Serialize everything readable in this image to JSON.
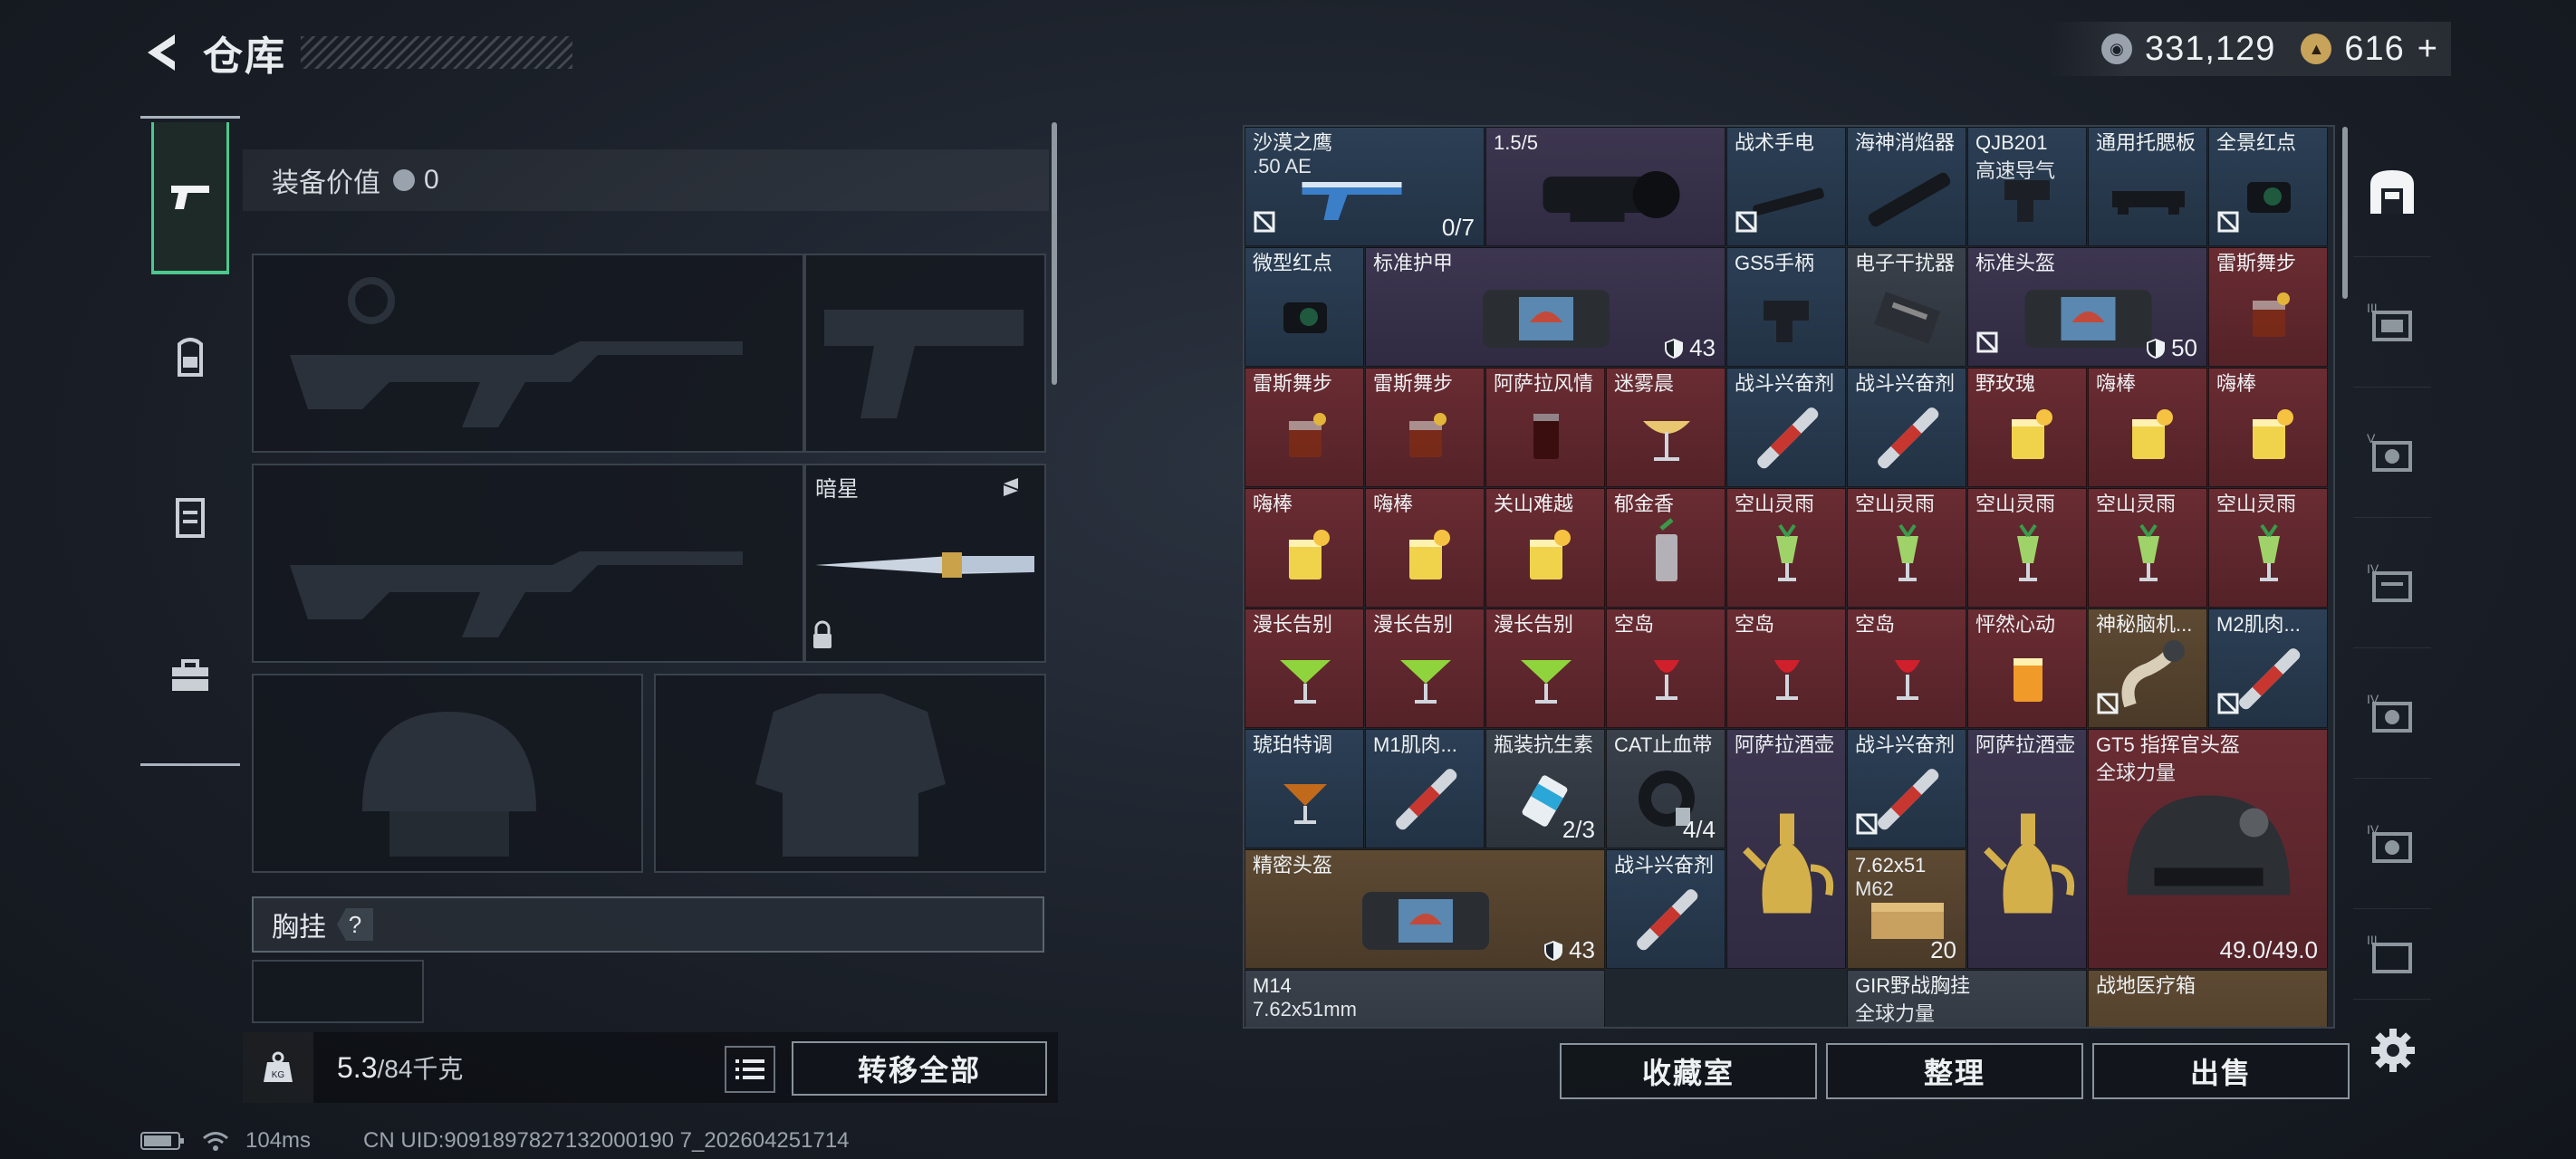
{
  "header": {
    "title": "仓库"
  },
  "currency": {
    "coins": "331,129",
    "premium": "616",
    "premium_plus": "+"
  },
  "equipment": {
    "value_label": "装备价值",
    "value": "0",
    "melee_label": "暗星",
    "chest_label": "胸挂",
    "help": "?"
  },
  "weight": {
    "current": "5.3",
    "max": "/84千克"
  },
  "buttons": {
    "transfer_all": "转移全部",
    "collection": "收藏室",
    "sort": "整理",
    "sell": "出售"
  },
  "inventory": [
    {
      "name": "沙漠之鹰",
      "sub": ".50 AE",
      "qty": "0/7"
    },
    {
      "name": "1.5/5"
    },
    {
      "name": "战术手电"
    },
    {
      "name": "海神消焰器"
    },
    {
      "name": "QJB201",
      "sub": "高速导气"
    },
    {
      "name": "通用托腮板"
    },
    {
      "name": "全景红点"
    },
    {
      "name": "微型红点"
    },
    {
      "name": "标准护甲",
      "armor": "43"
    },
    {
      "name": "GS5手柄"
    },
    {
      "name": "电子干扰器"
    },
    {
      "name": "标准头盔",
      "armor": "50"
    },
    {
      "name": "雷斯舞步"
    },
    {
      "name": "雷斯舞步"
    },
    {
      "name": "雷斯舞步"
    },
    {
      "name": "阿萨拉风情"
    },
    {
      "name": "迷雾晨"
    },
    {
      "name": "战斗兴奋剂"
    },
    {
      "name": "战斗兴奋剂"
    },
    {
      "name": "野玫瑰"
    },
    {
      "name": "嗨棒"
    },
    {
      "name": "嗨棒"
    },
    {
      "name": "嗨棒"
    },
    {
      "name": "嗨棒"
    },
    {
      "name": "关山难越"
    },
    {
      "name": "郁金香"
    },
    {
      "name": "空山灵雨"
    },
    {
      "name": "空山灵雨"
    },
    {
      "name": "空山灵雨"
    },
    {
      "name": "空山灵雨"
    },
    {
      "name": "空山灵雨"
    },
    {
      "name": "漫长告别"
    },
    {
      "name": "漫长告别"
    },
    {
      "name": "漫长告别"
    },
    {
      "name": "空岛"
    },
    {
      "name": "空岛"
    },
    {
      "name": "空岛"
    },
    {
      "name": "怦然心动"
    },
    {
      "name": "神秘脑机..."
    },
    {
      "name": "M2肌肉..."
    },
    {
      "name": "琥珀特调"
    },
    {
      "name": "M1肌肉..."
    },
    {
      "name": "瓶装抗生素",
      "qty": "2/3"
    },
    {
      "name": "CAT止血带",
      "qty": "4/4"
    },
    {
      "name": "阿萨拉酒壶"
    },
    {
      "name": "战斗兴奋剂"
    },
    {
      "name": "阿萨拉酒壶"
    },
    {
      "name": "GT5 指挥官头盔",
      "sub": "全球力量",
      "qty": "49.0/49.0"
    },
    {
      "name": "精密头盔",
      "armor": "43"
    },
    {
      "name": "战斗兴奋剂"
    },
    {
      "name": "7.62x51",
      "sub": "M62",
      "qty": "20"
    },
    {
      "name": "M14",
      "sub": "7.62x51mm"
    },
    {
      "name": "GIR野战胸挂",
      "sub": "全球力量"
    },
    {
      "name": "战地医疗箱"
    }
  ],
  "status": {
    "ping": "104ms",
    "uid": "CN UID:9091897827132000190 7_202604251714"
  }
}
